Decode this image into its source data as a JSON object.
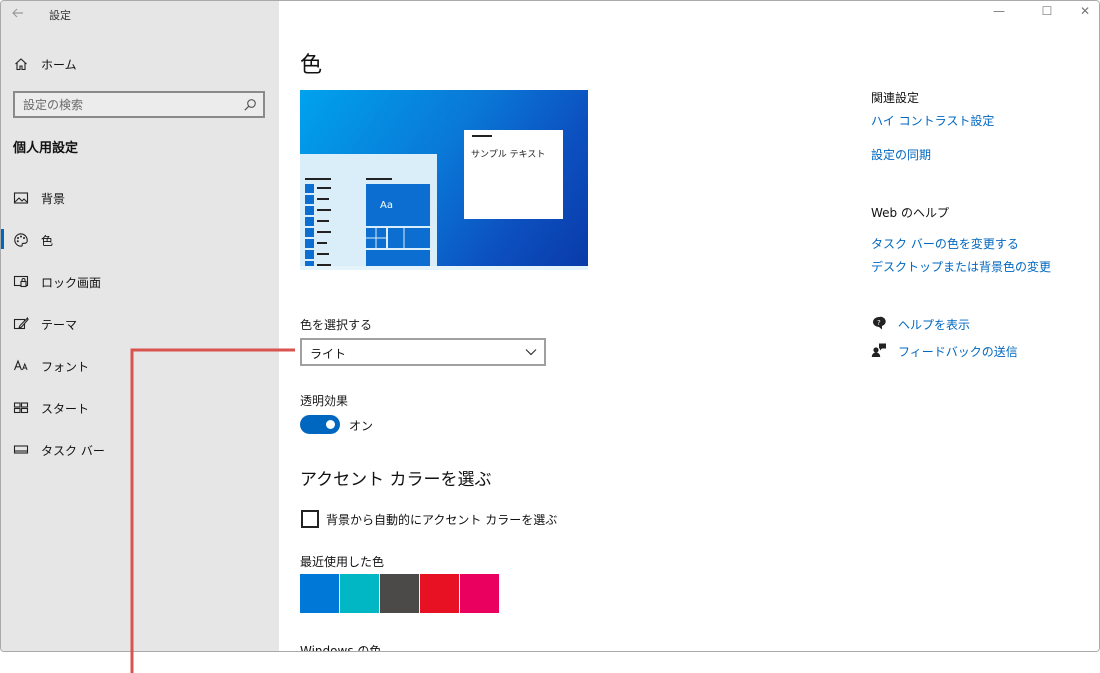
{
  "window": {
    "app_title": "設定",
    "controls": [
      "—",
      "☐",
      "✕"
    ]
  },
  "sidebar": {
    "home_label": "ホーム",
    "search_placeholder": "設定の検索",
    "section_title": "個人用設定",
    "items": [
      {
        "label": "背景",
        "icon": "picture-icon"
      },
      {
        "label": "色",
        "icon": "palette-icon",
        "active": true
      },
      {
        "label": "ロック画面",
        "icon": "lock-screen-icon"
      },
      {
        "label": "テーマ",
        "icon": "theme-brush-icon"
      },
      {
        "label": "フォント",
        "icon": "font-icon"
      },
      {
        "label": "スタート",
        "icon": "start-tiles-icon"
      },
      {
        "label": "タスク バー",
        "icon": "taskbar-icon"
      }
    ]
  },
  "main": {
    "title": "色",
    "preview": {
      "sample_text": "サンプル テキスト",
      "tile_text": "Aa"
    },
    "choose_color_label": "色を選択する",
    "choose_color_value": "ライト",
    "transparency_label": "透明効果",
    "transparency_state": "オン",
    "accent_heading": "アクセント カラーを選ぶ",
    "auto_accent_label": "背景から自動的にアクセント カラーを選ぶ",
    "recent_colors_label": "最近使用した色",
    "recent_colors": [
      "#0078d7",
      "#00b7c3",
      "#4c4a48",
      "#e81123",
      "#ea005e"
    ],
    "windows_colors_label": "Windows の色"
  },
  "related": {
    "heading": "関連設定",
    "high_contrast_link": "ハイ コントラスト設定",
    "sync_link": "設定の同期",
    "web_help_heading": "Web のヘルプ",
    "taskbar_color_link": "タスク バーの色を変更する",
    "desktop_color_link": "デスクトップまたは背景色の変更",
    "show_help_link": "ヘルプを表示",
    "feedback_link": "フィードバックの送信"
  },
  "colors": {
    "accent": "#0067c0",
    "sidebar_bg": "#e6e6e6",
    "annotation_line": "#d9534f"
  }
}
